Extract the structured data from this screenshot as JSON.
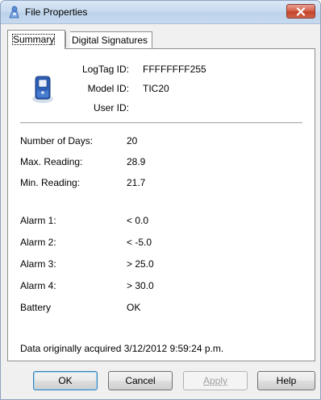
{
  "window": {
    "title": "File Properties"
  },
  "tabs": [
    {
      "label": "Summary",
      "active": true
    },
    {
      "label": "Digital Signatures",
      "active": false
    }
  ],
  "device": {
    "logtag_id_label": "LogTag ID:",
    "logtag_id_value": "FFFFFFFF255",
    "model_id_label": "Model ID:",
    "model_id_value": "TIC20",
    "user_id_label": "User ID:",
    "user_id_value": ""
  },
  "summary": {
    "days_label": "Number of Days:",
    "days_value": "20",
    "max_label": "Max. Reading:",
    "max_value": "28.9",
    "min_label": "Min. Reading:",
    "min_value": "21.7"
  },
  "alarms": [
    {
      "label": "Alarm 1:",
      "value": "< 0.0"
    },
    {
      "label": "Alarm 2:",
      "value": "< -5.0"
    },
    {
      "label": "Alarm 3:",
      "value": "> 25.0"
    },
    {
      "label": "Alarm 4:",
      "value": "> 30.0"
    }
  ],
  "battery": {
    "label": "Battery",
    "value": "OK"
  },
  "footer_note": "Data originally acquired 3/12/2012 9:59:24 p.m.",
  "buttons": {
    "ok": "OK",
    "cancel": "Cancel",
    "apply": "Apply",
    "help": "Help"
  },
  "icons": {
    "title_icon": "logtag-app-icon",
    "device_icon": "logtag-device-icon",
    "close_icon": "close-icon"
  },
  "colors": {
    "titlebar": "#c9dbef",
    "close_button": "#c34329",
    "dialog_bg": "#f0f0f0",
    "panel_bg": "#ffffff"
  }
}
